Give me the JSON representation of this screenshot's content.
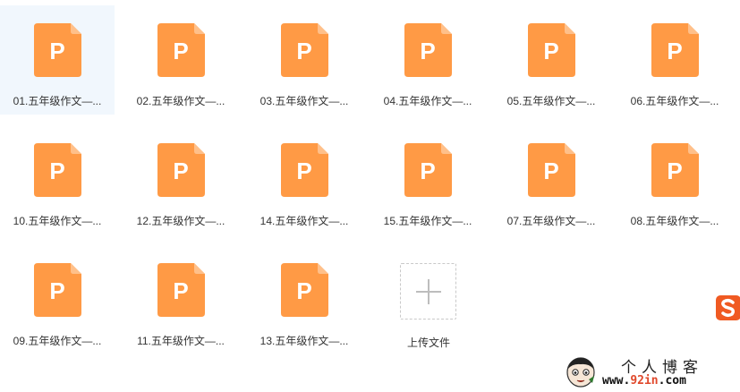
{
  "files": [
    {
      "label": "01.五年级作文—...",
      "selected": true
    },
    {
      "label": "02.五年级作文—..."
    },
    {
      "label": "03.五年级作文—..."
    },
    {
      "label": "04.五年级作文—..."
    },
    {
      "label": "05.五年级作文—..."
    },
    {
      "label": "06.五年级作文—..."
    },
    {
      "label": "10.五年级作文—..."
    },
    {
      "label": "12.五年级作文—..."
    },
    {
      "label": "14.五年级作文—..."
    },
    {
      "label": "15.五年级作文—..."
    },
    {
      "label": "07.五年级作文—..."
    },
    {
      "label": "08.五年级作文—..."
    },
    {
      "label": "09.五年级作文—..."
    },
    {
      "label": "11.五年级作文—..."
    },
    {
      "label": "13.五年级作文—..."
    }
  ],
  "file_icon": {
    "name": "powerpoint-file-icon",
    "letter": "P",
    "color": "#ff9a45",
    "fold_color": "#ffc08a"
  },
  "upload": {
    "label": "上传文件",
    "icon": "plus-icon"
  },
  "watermark": {
    "logo_icon": "sogou-logo-icon",
    "title": "个人博客",
    "url_prefix": "www.",
    "url_accent": "92in",
    "url_suffix": ".com"
  }
}
